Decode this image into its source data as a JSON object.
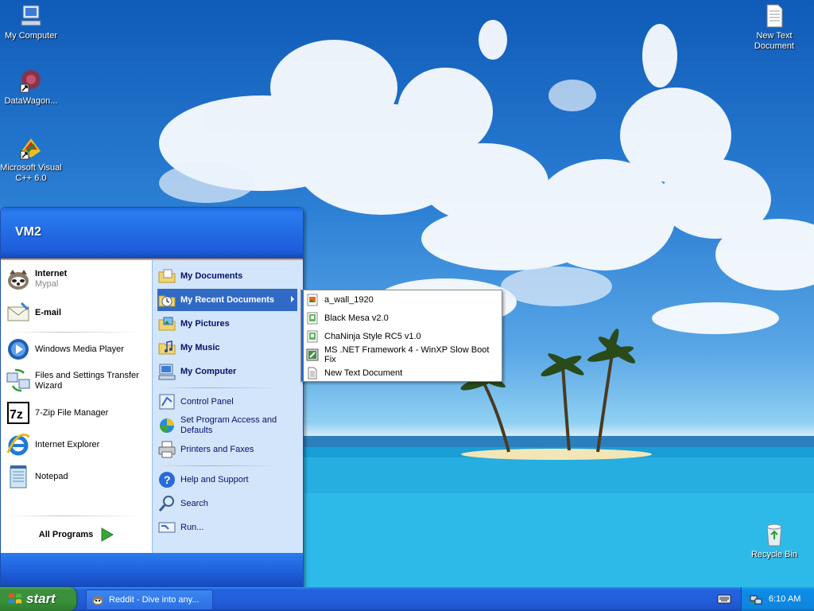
{
  "desktop": {
    "icons": [
      {
        "label": "My Computer"
      },
      {
        "label": "DataWagon..."
      },
      {
        "label": "Microsoft Visual C++ 6.0"
      },
      {
        "label": "New Text Document"
      },
      {
        "label": "Recycle Bin"
      }
    ]
  },
  "start_menu": {
    "user": "VM2",
    "left": {
      "internet": {
        "label": "Internet",
        "sub": "Mypal"
      },
      "email": {
        "label": "E-mail"
      },
      "programs": [
        {
          "label": "Windows Media Player"
        },
        {
          "label": "Files and Settings Transfer Wizard"
        },
        {
          "label": "7-Zip File Manager"
        },
        {
          "label": "Internet Explorer"
        },
        {
          "label": "Notepad"
        }
      ],
      "all_programs": "All Programs"
    },
    "right": {
      "items": [
        {
          "label": "My Documents"
        },
        {
          "label": "My Recent Documents"
        },
        {
          "label": "My Pictures"
        },
        {
          "label": "My Music"
        },
        {
          "label": "My Computer"
        },
        {
          "label": "Control Panel"
        },
        {
          "label": "Set Program Access and Defaults"
        },
        {
          "label": "Printers and Faxes"
        },
        {
          "label": "Help and Support"
        },
        {
          "label": "Search"
        },
        {
          "label": "Run..."
        }
      ]
    },
    "recent_documents": [
      {
        "label": "a_wall_1920"
      },
      {
        "label": "Black Mesa v2.0"
      },
      {
        "label": "ChaNinja Style RC5 v1.0"
      },
      {
        "label": "MS .NET Framework 4 - WinXP Slow Boot Fix"
      },
      {
        "label": "New Text Document"
      }
    ]
  },
  "taskbar": {
    "start_label": "start",
    "tasks": [
      {
        "label": "Reddit - Dive into any..."
      }
    ],
    "clock": "6:10 AM"
  }
}
